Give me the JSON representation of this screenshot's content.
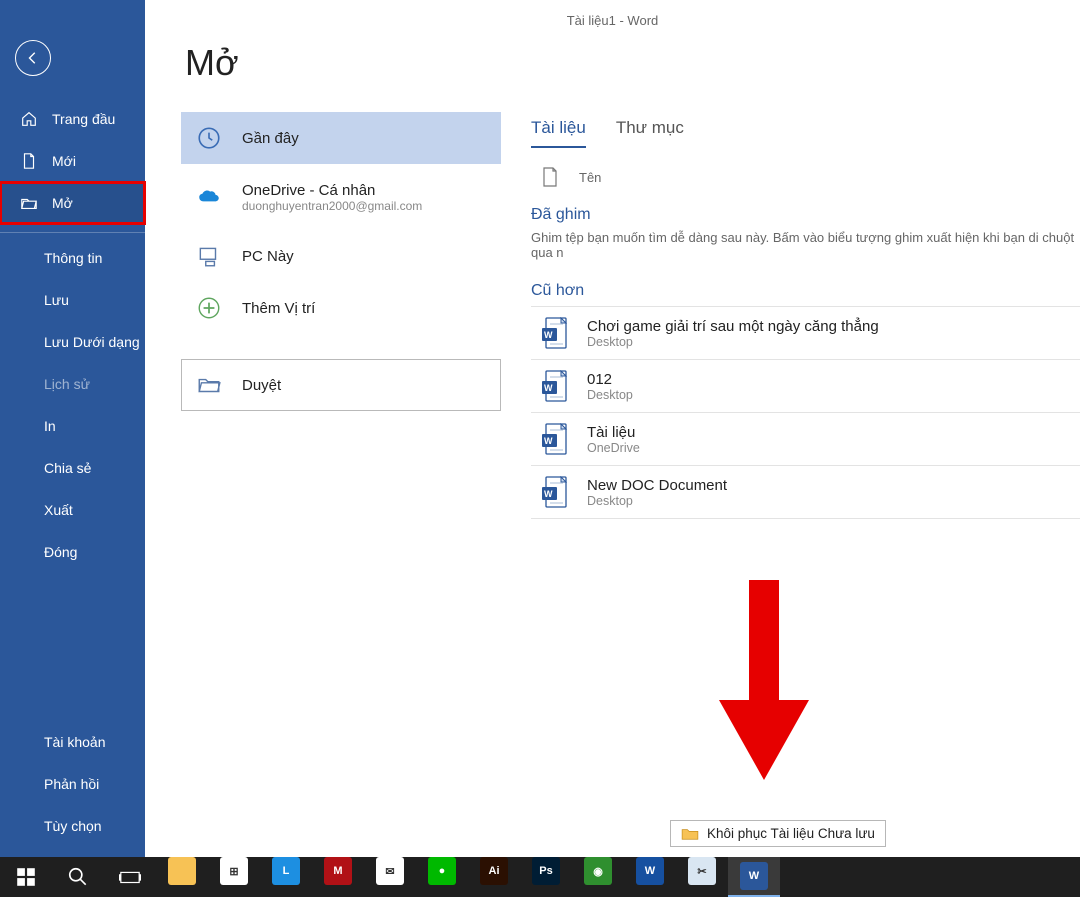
{
  "window": {
    "title": "Tài liệu1  -  Word"
  },
  "page": {
    "heading": "Mở"
  },
  "sidebar": {
    "home": "Trang đầu",
    "new": "Mới",
    "open": "Mở",
    "info": "Thông tin",
    "save": "Lưu",
    "saveas": "Lưu Dưới dạng",
    "history": "Lịch sử",
    "print": "In",
    "share": "Chia sẻ",
    "export": "Xuất",
    "close": "Đóng",
    "account": "Tài khoản",
    "feedback": "Phản hồi",
    "options": "Tùy chọn"
  },
  "locations": {
    "recent": "Gần đây",
    "onedrive": {
      "title": "OneDrive - Cá nhân",
      "email": "duonghuyentran2000@gmail.com"
    },
    "thispc": "PC Này",
    "addplace": "Thêm Vị trí",
    "browse": "Duyệt"
  },
  "tabs": {
    "documents": "Tài liệu",
    "folders": "Thư mục"
  },
  "list": {
    "name_col": "Tên",
    "pinned_label": "Đã ghim",
    "pinned_hint": "Ghim tệp bạn muốn tìm dễ dàng sau này. Bấm vào biểu tượng ghim xuất hiện khi bạn di chuột qua n",
    "older_label": "Cũ hơn",
    "files": [
      {
        "name": "Chơi game giải trí sau một ngày căng thẳng",
        "loc": "Desktop"
      },
      {
        "name": "012",
        "loc": "Desktop"
      },
      {
        "name": "Tài liệu",
        "loc": "OneDrive"
      },
      {
        "name": "New DOC Document",
        "loc": "Desktop"
      }
    ]
  },
  "restore_button": "Khôi phục Tài liệu Chưa lưu",
  "taskbar": {
    "apps": [
      {
        "name": "file-explorer",
        "color": "#f7c255",
        "label": ""
      },
      {
        "name": "microsoft-store",
        "color": "#ffffff",
        "label": "⊞"
      },
      {
        "name": "app-l",
        "color": "#1d8fe1",
        "label": "L"
      },
      {
        "name": "mcafee",
        "color": "#b11116",
        "label": "M"
      },
      {
        "name": "mail",
        "color": "#ffffff",
        "label": "✉"
      },
      {
        "name": "line",
        "color": "#00b900",
        "label": "●"
      },
      {
        "name": "illustrator",
        "color": "#2b1002",
        "label": "Ai"
      },
      {
        "name": "photoshop",
        "color": "#001d34",
        "label": "Ps"
      },
      {
        "name": "coccoc",
        "color": "#2f8f2f",
        "label": "◉"
      },
      {
        "name": "wps",
        "color": "#1650a0",
        "label": "W"
      },
      {
        "name": "snip",
        "color": "#d9e6f2",
        "label": "✂"
      },
      {
        "name": "word",
        "color": "#2b579a",
        "label": "W"
      }
    ]
  }
}
